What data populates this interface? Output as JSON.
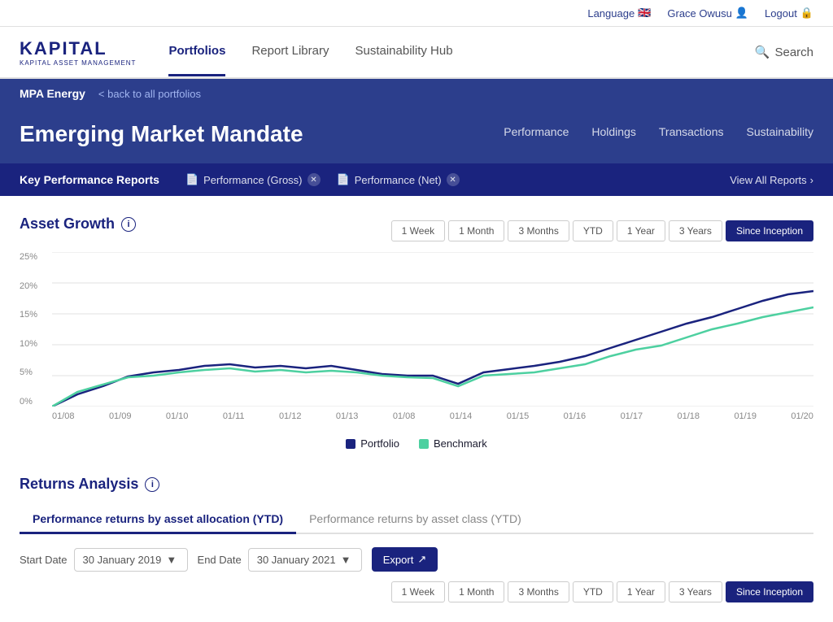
{
  "topbar": {
    "language_label": "Language",
    "user_name": "Grace Owusu",
    "logout_label": "Logout"
  },
  "nav": {
    "logo_title": "KAPITAL",
    "logo_sub": "KAPITAL ASSET MANAGEMENT",
    "links": [
      {
        "label": "Portfolios",
        "active": true
      },
      {
        "label": "Report Library",
        "active": false
      },
      {
        "label": "Sustainability Hub",
        "active": false
      }
    ],
    "search_label": "Search"
  },
  "breadcrumb": {
    "portfolio_name": "MPA Energy",
    "back_label": "< back to all portfolios"
  },
  "portfolio": {
    "title": "Emerging Market Mandate",
    "tabs": [
      "Performance",
      "Holdings",
      "Transactions",
      "Sustainability"
    ]
  },
  "reports_bar": {
    "title": "Key Performance Reports",
    "reports": [
      {
        "label": "Performance (Gross)"
      },
      {
        "label": "Performance (Net)"
      }
    ],
    "view_all": "View All Reports"
  },
  "asset_growth": {
    "title": "Asset Growth",
    "time_filters": [
      "1 Week",
      "1 Month",
      "3 Months",
      "YTD",
      "1 Year",
      "3 Years",
      "Since Inception"
    ],
    "active_filter": "Since Inception",
    "y_labels": [
      "25%",
      "20%",
      "15%",
      "10%",
      "5%",
      "0%"
    ],
    "x_labels": [
      "01/08",
      "01/09",
      "01/10",
      "01/11",
      "01/12",
      "01/13",
      "01/08",
      "01/14",
      "01/15",
      "01/16",
      "01/17",
      "01/18",
      "01/19",
      "01/20"
    ],
    "legend": [
      {
        "label": "Portfolio",
        "color": "#1a237e"
      },
      {
        "label": "Benchmark",
        "color": "#4dd0a0"
      }
    ]
  },
  "returns_analysis": {
    "title": "Returns Analysis",
    "tabs": [
      {
        "label": "Performance returns by asset allocation (YTD)",
        "active": true
      },
      {
        "label": "Performance returns by asset class (YTD)",
        "active": false
      }
    ],
    "start_date_label": "Start Date",
    "start_date_value": "30 January 2019",
    "end_date_label": "End Date",
    "end_date_value": "30 January 2021",
    "export_label": "Export",
    "time_filters": [
      "1 Week",
      "1 Month",
      "3 Months",
      "YTD",
      "1 Year",
      "3 Years",
      "Since Inception"
    ],
    "active_filter": "Since Inception"
  }
}
